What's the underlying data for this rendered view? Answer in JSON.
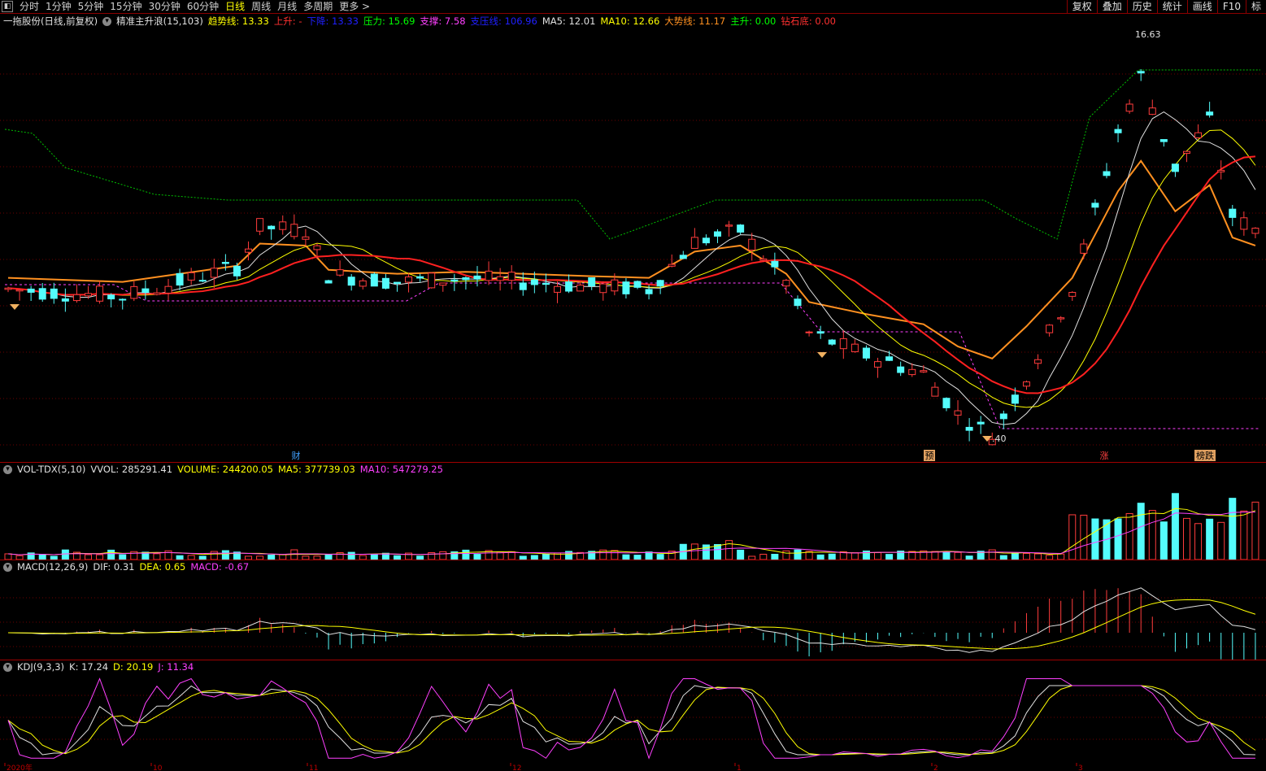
{
  "topbar": {
    "periods": [
      {
        "label": "分时",
        "active": false
      },
      {
        "label": "1分钟",
        "active": false
      },
      {
        "label": "5分钟",
        "active": false
      },
      {
        "label": "15分钟",
        "active": false
      },
      {
        "label": "30分钟",
        "active": false
      },
      {
        "label": "60分钟",
        "active": false
      },
      {
        "label": "日线",
        "active": true
      },
      {
        "label": "周线",
        "active": false
      },
      {
        "label": "月线",
        "active": false
      },
      {
        "label": "多周期",
        "active": false
      },
      {
        "label": "更多 >",
        "active": false
      }
    ],
    "tools": [
      "复权",
      "叠加",
      "历史",
      "统计",
      "画线",
      "F10",
      "标"
    ]
  },
  "main_legend": {
    "stock": "一拖股份(日线,前复权)",
    "indicator": "精准主升浪(15,103)",
    "items": [
      {
        "label": "趋势线: 13.33",
        "color": "#ffff00"
      },
      {
        "label": "上升: -",
        "color": "#ff3030"
      },
      {
        "label": "下降: 13.33",
        "color": "#2020ff"
      },
      {
        "label": "压力: 15.69",
        "color": "#00ff00"
      },
      {
        "label": "支撑: 7.58",
        "color": "#ff40ff"
      },
      {
        "label": "支压线: 106.96",
        "color": "#2020ff"
      },
      {
        "label": "MA5: 12.01",
        "color": "#e0e0e0"
      },
      {
        "label": "MA10: 12.66",
        "color": "#ffff00"
      },
      {
        "label": "大势线: 11.17",
        "color": "#ff9020"
      },
      {
        "label": "主升: 0.00",
        "color": "#00ff00"
      },
      {
        "label": "钻石底: 0.00",
        "color": "#ff3030"
      }
    ],
    "high_label": "16.63",
    "low_label": ".40",
    "markers": [
      {
        "text": "财",
        "color": "#40a0ff",
        "bg": "#000"
      },
      {
        "text": "预",
        "color": "#000",
        "bg": "#e0a060"
      },
      {
        "text": "涨",
        "color": "#ff4040",
        "bg": "#000"
      },
      {
        "text": "榜跌",
        "color": "#000",
        "bg": "#e0a060"
      }
    ]
  },
  "vol_legend": {
    "name": "VOL-TDX(5,10)",
    "items": [
      {
        "label": "VVOL: 285291.41",
        "color": "#e0e0e0"
      },
      {
        "label": "VOLUME: 244200.05",
        "color": "#ffff00"
      },
      {
        "label": "MA5: 377739.03",
        "color": "#ffff00"
      },
      {
        "label": "MA10: 547279.25",
        "color": "#ff40ff"
      }
    ]
  },
  "macd_legend": {
    "name": "MACD(12,26,9)",
    "items": [
      {
        "label": "DIF: 0.31",
        "color": "#e0e0e0"
      },
      {
        "label": "DEA: 0.65",
        "color": "#ffff00"
      },
      {
        "label": "MACD: -0.67",
        "color": "#ff40ff"
      }
    ]
  },
  "kdj_legend": {
    "name": "KDJ(9,3,3)",
    "items": [
      {
        "label": "K: 17.24",
        "color": "#e0e0e0"
      },
      {
        "label": "D: 20.19",
        "color": "#ffff00"
      },
      {
        "label": "J: 11.34",
        "color": "#ff40ff"
      }
    ]
  },
  "x_axis": [
    "2020年",
    "10",
    "11",
    "12",
    "1",
    "2",
    "3"
  ],
  "colors": {
    "up": "#ff3c3c",
    "down": "#54fcfc",
    "background": "#000000",
    "grid": "#6b0000"
  }
}
